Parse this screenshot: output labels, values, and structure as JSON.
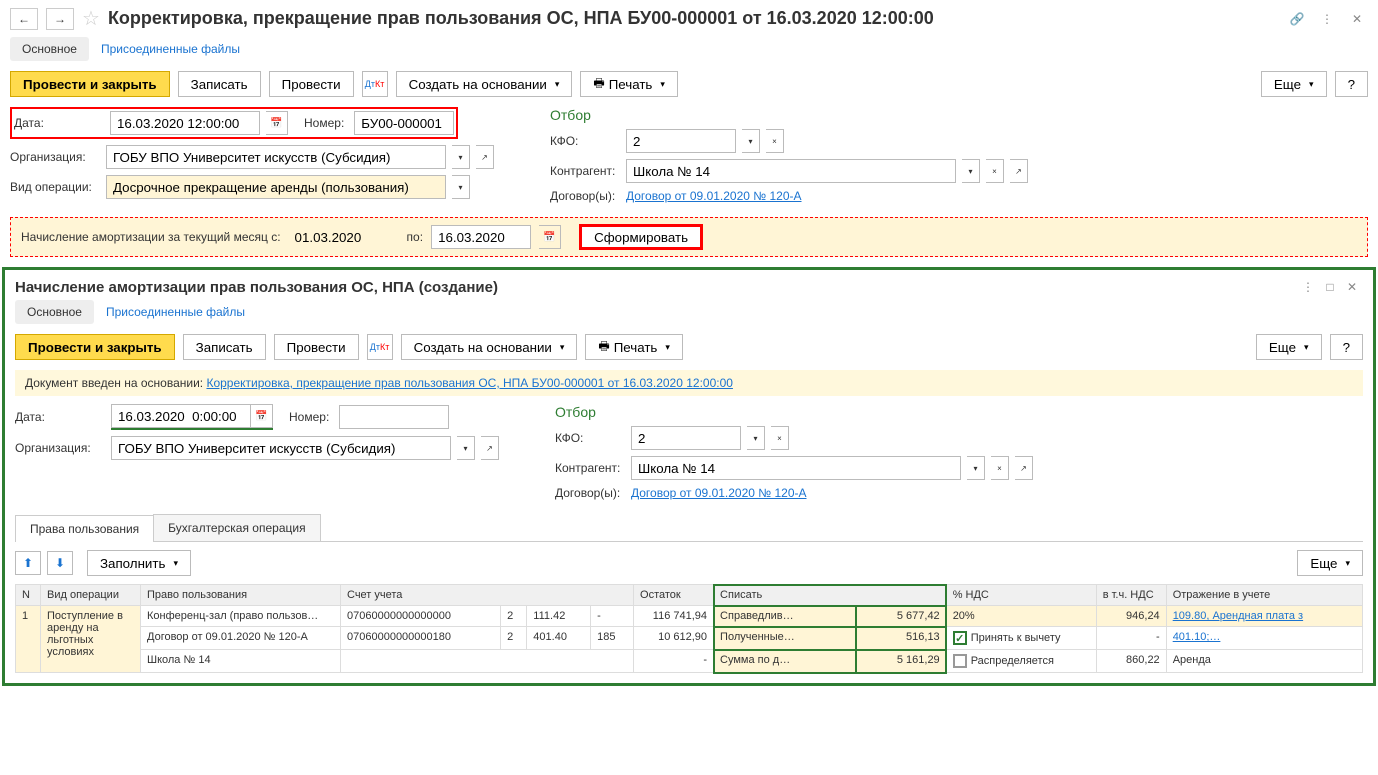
{
  "header": {
    "title": "Корректировка, прекращение прав пользования ОС, НПА БУ00-000001 от 16.03.2020 12:00:00"
  },
  "top_tabs": {
    "main": "Основное",
    "files": "Присоединенные файлы"
  },
  "toolbar": {
    "post_close": "Провести и закрыть",
    "save": "Записать",
    "post": "Провести",
    "create_based": "Создать на основании",
    "print": "Печать",
    "more": "Еще",
    "help": "?"
  },
  "form1": {
    "date_label": "Дата:",
    "date_value": "16.03.2020 12:00:00",
    "number_label": "Номер:",
    "number_value": "БУ00-000001",
    "org_label": "Организация:",
    "org_value": "ГОБУ ВПО Университет искусств (Субсидия)",
    "optype_label": "Вид операции:",
    "optype_value": "Досрочное прекращение аренды (пользования)",
    "filter_title": "Отбор",
    "kfo_label": "КФО:",
    "kfo_value": "2",
    "contr_label": "Контрагент:",
    "contr_value": "Школа № 14",
    "contracts_label": "Договор(ы):",
    "contracts_link": "Договор от 09.01.2020 № 120-А"
  },
  "amort": {
    "label": "Начисление амортизации за текущий месяц с:",
    "from": "01.03.2020",
    "to_label": "по:",
    "to": "16.03.2020",
    "form_btn": "Сформировать"
  },
  "sub": {
    "title": "Начисление амортизации прав пользования ОС, НПА (создание)",
    "info_label": "Документ введен на основании:",
    "info_link": "Корректировка, прекращение прав пользования ОС, НПА БУ00-000001 от 16.03.2020 12:00:00",
    "date_value": "16.03.2020  0:00:00",
    "number_value": "",
    "tabs": {
      "rights": "Права пользования",
      "accounting": "Бухгалтерская операция"
    },
    "fill_btn": "Заполнить"
  },
  "table": {
    "headers": {
      "n": "N",
      "optype": "Вид операции",
      "right": "Право пользования",
      "account": "Счет учета",
      "remainder": "Остаток",
      "writeoff": "Списать",
      "vat_pct": "% НДС",
      "vat_incl": "в т.ч. НДС",
      "reflection": "Отражение в учете"
    },
    "row": {
      "n": "1",
      "optype": "Поступление в аренду на льготных условиях",
      "right1": "Конференц-зал (право пользов…",
      "right2": "Договор от 09.01.2020 № 120-А",
      "right3": "Школа № 14",
      "acct1": "07060000000000000",
      "acct2": "07060000000000180",
      "acct1_k": "2",
      "acct2_k": "2",
      "acct1_s": "111.42",
      "acct2_s": "401.40",
      "acct1_d": "-",
      "acct2_d": "185",
      "rem1": "116 741,94",
      "rem2": "10 612,90",
      "rem3": "-",
      "wo_label1": "Справедлив…",
      "wo_val1": "5 677,42",
      "wo_label2": "Полученные…",
      "wo_val2": "516,13",
      "wo_label3": "Сумма по д…",
      "wo_val3": "5 161,29",
      "vat_pct": "20%",
      "vat_deduct": "Принять к вычету",
      "vat_dist": "Распределяется",
      "vat_incl1": "946,24",
      "vat_incl2": "-",
      "vat_incl3": "860,22",
      "refl1": "109.80, Арендная плата з",
      "refl2": "401.10;…",
      "refl3": "Аренда"
    }
  }
}
